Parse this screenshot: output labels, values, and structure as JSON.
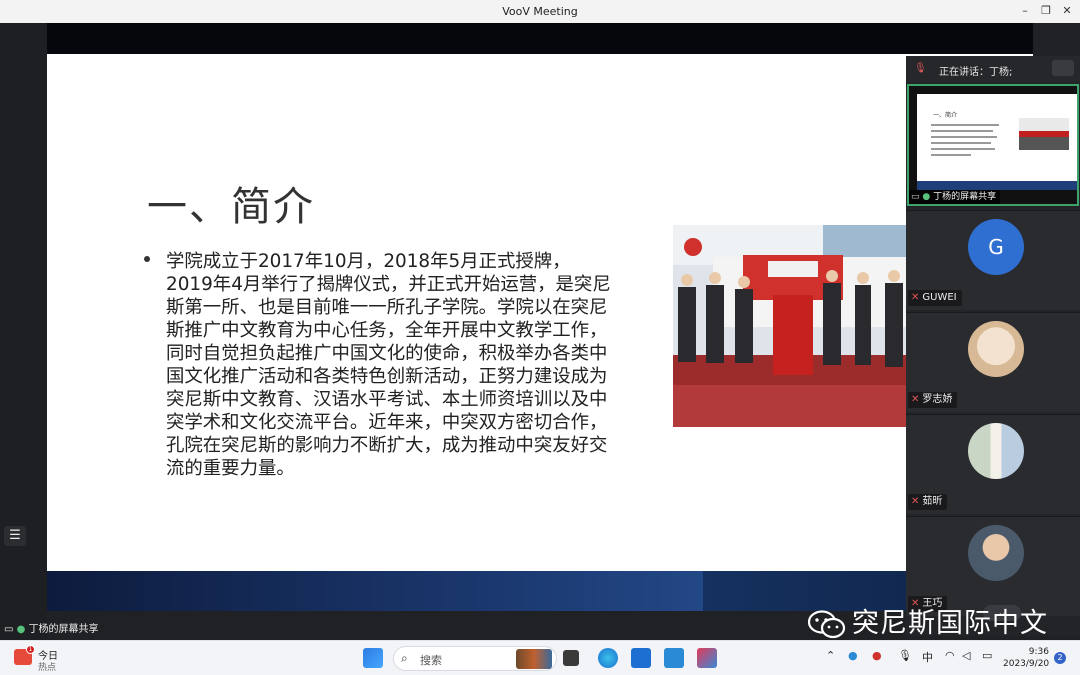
{
  "window": {
    "title": "VooV Meeting"
  },
  "slide": {
    "title": "一、简介",
    "body": "学院成立于2017年10月，2018年5月正式授牌，2019年4月举行了揭牌仪式，并正式开始运营，是突尼斯第一所、也是目前唯一一所孔子学院。学院以在突尼斯推广中文教育为中心任务，全年开展中文教学工作，同时自觉担负起推广中国文化的使命，积极举办各类中国文化推广活动和各类特色创新活动，正努力建设成为突尼斯中文教育、汉语水平考试、本土师资培训以及中突学术和文化交流平台。近年来，中突双方密切合作，孔院在突尼斯的影响力不断扩大，成为推动中突友好交流的重要力量。"
  },
  "panel": {
    "speaking_label": "正在讲话：丁杨;",
    "share_tile_label": "丁杨的屏幕共享",
    "mini_slide_title": "一、简介",
    "participants": [
      {
        "name": "GUWEI",
        "initial": "G"
      },
      {
        "name": "罗志娇"
      },
      {
        "name": "茹昕"
      },
      {
        "name": "王巧"
      }
    ]
  },
  "bottom_share_label": "丁杨的屏幕共享",
  "watermark": "突尼斯国际中文",
  "taskbar": {
    "weather_title": "今日",
    "weather_sub": "热点",
    "weather_badge": "1",
    "search_placeholder": "搜索",
    "ime": "中",
    "time": "9:36",
    "date": "2023/9/20",
    "notification_count": "2"
  },
  "colors": {
    "accent_green": "#3ea26b",
    "avatar_blue": "#2f6fd1",
    "slide_bar": "#1e3f7a"
  }
}
